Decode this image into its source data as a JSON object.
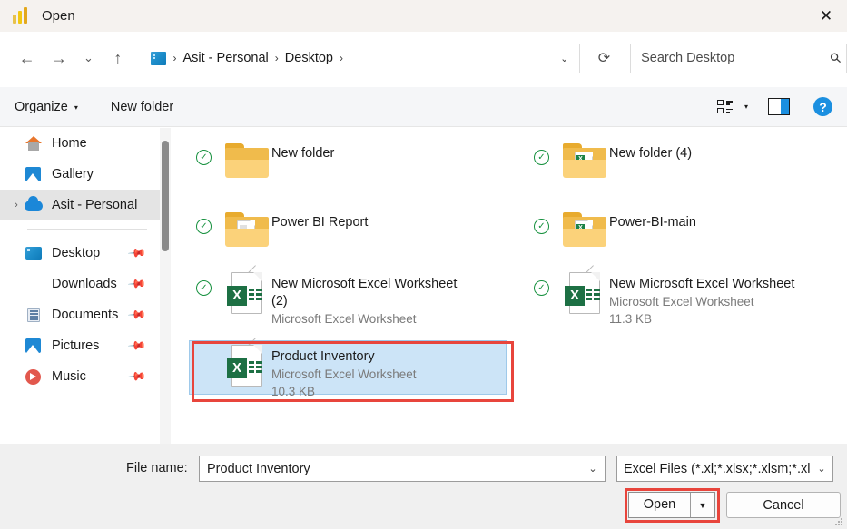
{
  "titlebar": {
    "icon": "power-bi-icon",
    "title": "Open",
    "close_label": "✕"
  },
  "nav": {
    "back": "←",
    "forward": "→",
    "recent": "⌄",
    "up": "↑",
    "breadcrumb": {
      "root_icon": "desktop-icon",
      "separator": "›",
      "items": [
        "Asit - Personal",
        "Desktop"
      ],
      "dropdown": "⌄"
    },
    "refresh": "⟳",
    "search": {
      "placeholder": "Search Desktop",
      "value": "",
      "icon": "search-icon"
    }
  },
  "toolbar": {
    "organize": "Organize",
    "organize_caret": "▾",
    "new_folder": "New folder",
    "view_caret": "▾",
    "help": "?"
  },
  "sidebar": {
    "items": [
      {
        "label": "Home",
        "icon": "home-icon",
        "pinned": false,
        "selected": false,
        "expandable": false
      },
      {
        "label": "Gallery",
        "icon": "gallery-icon",
        "pinned": false,
        "selected": false,
        "expandable": false
      },
      {
        "label": "Asit - Personal",
        "icon": "onedrive-cloud-icon",
        "pinned": false,
        "selected": true,
        "expandable": true,
        "chevron": "›"
      },
      {
        "label": "Desktop",
        "icon": "desktop-icon",
        "pinned": true,
        "selected": false,
        "expandable": false
      },
      {
        "label": "Downloads",
        "icon": "downloads-icon",
        "pinned": true,
        "selected": false,
        "expandable": false
      },
      {
        "label": "Documents",
        "icon": "documents-icon",
        "pinned": true,
        "selected": false,
        "expandable": false
      },
      {
        "label": "Pictures",
        "icon": "pictures-icon",
        "pinned": true,
        "selected": false,
        "expandable": false
      },
      {
        "label": "Music",
        "icon": "music-icon",
        "pinned": true,
        "selected": false,
        "expandable": false
      }
    ],
    "pin_glyph": "📌"
  },
  "files": [
    {
      "name": "New folder",
      "type": "folder",
      "sub": "",
      "size": "",
      "sync": "✓",
      "selected": false,
      "folder_has_sheet": false
    },
    {
      "name": "New folder (4)",
      "type": "folder",
      "sub": "",
      "size": "",
      "sync": "✓",
      "selected": false,
      "folder_has_sheet": true
    },
    {
      "name": "Power BI Report",
      "type": "folder",
      "sub": "",
      "size": "",
      "sync": "✓",
      "selected": false,
      "folder_has_sheet": true,
      "sheet_plain": true
    },
    {
      "name": "Power-BI-main",
      "type": "folder",
      "sub": "",
      "size": "",
      "sync": "✓",
      "selected": false,
      "folder_has_sheet": true
    },
    {
      "name": "New Microsoft Excel Worksheet (2)",
      "type": "excel",
      "sub": "Microsoft Excel Worksheet",
      "size": "",
      "sync": "✓",
      "selected": false
    },
    {
      "name": "New Microsoft Excel Worksheet",
      "type": "excel",
      "sub": "Microsoft Excel Worksheet",
      "size": "11.3 KB",
      "sync": "✓",
      "selected": false
    },
    {
      "name": "Product Inventory",
      "type": "excel",
      "sub": "Microsoft Excel Worksheet",
      "size": "10.3 KB",
      "sync": "✓",
      "selected": true
    }
  ],
  "excel_icon_letter": "X",
  "bottom": {
    "filename_label": "File name:",
    "filename_value": "Product Inventory",
    "filename_chevron": "⌄",
    "filter_value": "Excel Files (*.xl;*.xlsx;*.xlsm;*.xlsl",
    "filter_chevron": "⌄",
    "open_label": "Open",
    "open_arrow": "▼",
    "cancel_label": "Cancel"
  },
  "colors": {
    "selection_fill": "#cce4f7",
    "annotation_red": "#e8453c",
    "accent_blue": "#1b8fe0",
    "sync_green": "#17913f",
    "excel_green": "#1d7044"
  }
}
